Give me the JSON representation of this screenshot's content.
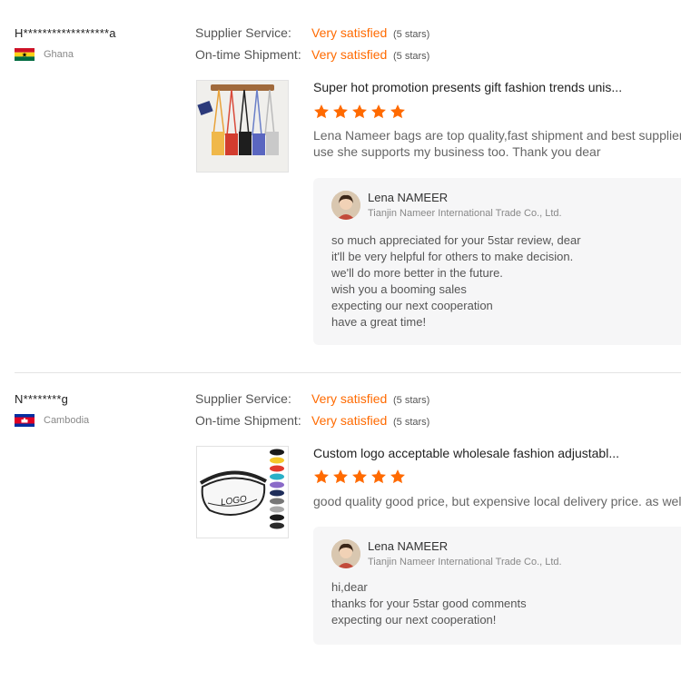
{
  "reviews": [
    {
      "buyer": "H******************a",
      "country": "Ghana",
      "supplier_service_label": "Supplier Service:",
      "supplier_service_value": "Very satisfied",
      "supplier_service_stars": "(5 stars)",
      "shipment_label": "On-time Shipment:",
      "shipment_value": "Very satisfied",
      "shipment_stars": "(5 stars)",
      "product_title": "Super hot promotion presents gift fashion trends unis...",
      "rating": 5,
      "comment": "Lena Nameer bags are top quality,fast shipment and best supplier.\nuse she supports my business too. Thank you dear",
      "reply": {
        "name": "Lena NAMEER",
        "company": "Tianjin Nameer International Trade Co., Ltd.",
        "text": "so much appreciated for your 5star review, dear\nit'll be very helpful for others to make decision.\nwe'll do more better in the future.\nwish you a booming sales\nexpecting our next cooperation\nhave a great time!"
      }
    },
    {
      "buyer": "N********g",
      "country": "Cambodia",
      "supplier_service_label": "Supplier Service:",
      "supplier_service_value": "Very satisfied",
      "supplier_service_stars": "(5 stars)",
      "shipment_label": "On-time Shipment:",
      "shipment_value": "Very satisfied",
      "shipment_stars": "(5 stars)",
      "product_title": "Custom logo acceptable wholesale fashion adjustabl...",
      "product_image_text": "LOGO",
      "rating": 5,
      "comment": "good quality good price, but expensive local delivery price. as well as",
      "reply": {
        "name": "Lena NAMEER",
        "company": "Tianjin Nameer International Trade Co., Ltd.",
        "text": "hi,dear\nthanks for your 5star good comments\nexpecting our next cooperation!"
      }
    }
  ],
  "colors": {
    "accent": "#ff6a00",
    "reply_bg": "#f6f6f7",
    "divider": "#e3e3e3"
  },
  "icons": {
    "rating_star": "star-icon",
    "flags": [
      "ghana-flag-icon",
      "cambodia-flag-icon"
    ]
  }
}
